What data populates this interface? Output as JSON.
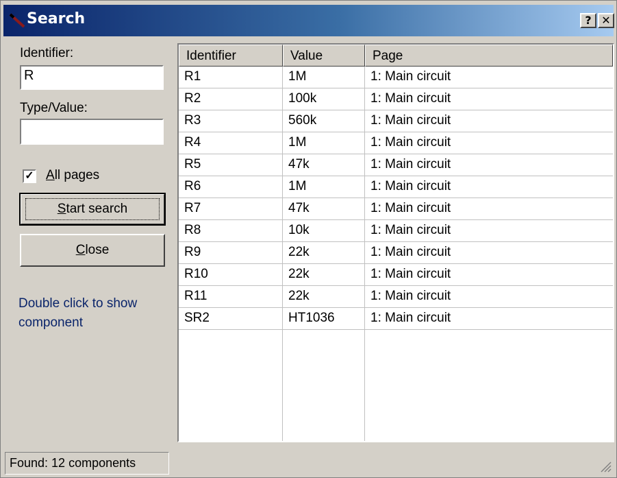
{
  "window": {
    "title": "Search",
    "help_label": "?",
    "close_label": "✕"
  },
  "form": {
    "identifier_label": "Identifier:",
    "identifier_value": "R",
    "type_value_label": "Type/Value:",
    "type_value_value": "",
    "all_pages_label": "All pages",
    "all_pages_checked": true,
    "start_search_label": "Start search",
    "close_label": "Close",
    "hint": "Double click to show component"
  },
  "results": {
    "columns": [
      "Identifier",
      "Value",
      "Page"
    ],
    "rows": [
      [
        "R1",
        "1M",
        "1: Main circuit"
      ],
      [
        "R2",
        "100k",
        "1: Main circuit"
      ],
      [
        "R3",
        "560k",
        "1: Main circuit"
      ],
      [
        "R4",
        "1M",
        "1: Main circuit"
      ],
      [
        "R5",
        "47k",
        "1: Main circuit"
      ],
      [
        "R6",
        "1M",
        "1: Main circuit"
      ],
      [
        "R7",
        "47k",
        "1: Main circuit"
      ],
      [
        "R8",
        "10k",
        "1: Main circuit"
      ],
      [
        "R9",
        "22k",
        "1: Main circuit"
      ],
      [
        "R10",
        "22k",
        "1: Main circuit"
      ],
      [
        "R11",
        "22k",
        "1: Main circuit"
      ],
      [
        "SR2",
        "HT1036",
        "1: Main circuit"
      ]
    ]
  },
  "status": {
    "text": "Found: 12 components"
  }
}
